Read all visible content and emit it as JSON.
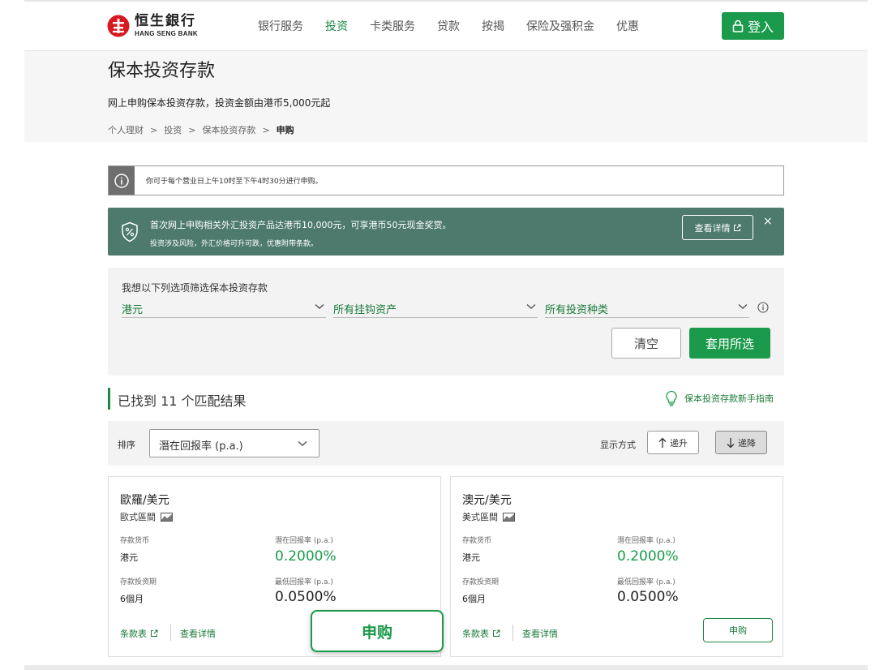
{
  "header": {
    "logo_cn": "恒生銀行",
    "logo_en": "HANG SENG BANK",
    "nav": [
      "银行服务",
      "投资",
      "卡类服务",
      "贷款",
      "按揭",
      "保险及强积金",
      "优惠"
    ],
    "nav_active": "投资",
    "login_label": "登入"
  },
  "hero": {
    "title": "保本投资存款",
    "subtitle": "网上申购保本投资存款，投资金额由港币5,000元起",
    "breadcrumb": [
      "个人理财",
      "投资",
      "保本投资存款",
      "申购"
    ]
  },
  "notice": {
    "text": "你可于每个营业日上午10时至下午4时30分进行申购。"
  },
  "promo": {
    "line1": "首次网上申购相关外汇投资产品达港币10,000元，可享港币50元现金奖赏。",
    "line2": "投资涉及风险，外汇价格可升可跌，优惠附带条款。",
    "detail_label": "查看详情",
    "close": "×"
  },
  "filter": {
    "title": "我想以下列选项筛选保本投资存款",
    "currency": "港元",
    "underlying": "所有挂钩资产",
    "type": "所有投资种类",
    "clear_label": "清空",
    "apply_label": "套用所选"
  },
  "results": {
    "count_text": "已找到 11 个匹配结果",
    "guide_label": "保本投资存款新手指南"
  },
  "sort": {
    "label": "排序",
    "selected": "潛在回报率 (p.a.)",
    "display_label": "显示方式",
    "asc_label": "递升",
    "desc_label": "递降"
  },
  "cards": [
    {
      "title": "歐羅/美元",
      "type": "歐式區間",
      "ccy_label": "存款货币",
      "ccy": "港元",
      "potential_label": "潛在回报率 (p.a.)",
      "potential": "0.2000%",
      "tenor_label": "存款投资期",
      "tenor": "6個月",
      "min_label": "最低回报率 (p.a.)",
      "min": "0.0500%",
      "terms_label": "条款表",
      "details_label": "查看详情"
    },
    {
      "title": "澳元/美元",
      "type": "美式區間",
      "ccy_label": "存款货币",
      "ccy": "港元",
      "potential_label": "潛在回报率 (p.a.)",
      "potential": "0.2000%",
      "tenor_label": "存款投资期",
      "tenor": "6個月",
      "min_label": "最低回报率 (p.a.)",
      "min": "0.0500%",
      "terms_label": "条款表",
      "details_label": "查看详情",
      "apply_label": "申购"
    }
  ],
  "float_apply_label": "申购",
  "colors": {
    "brand_green": "#1a9a4a",
    "promo_bg": "#4d7a6d",
    "logo_red": "#d71920"
  }
}
